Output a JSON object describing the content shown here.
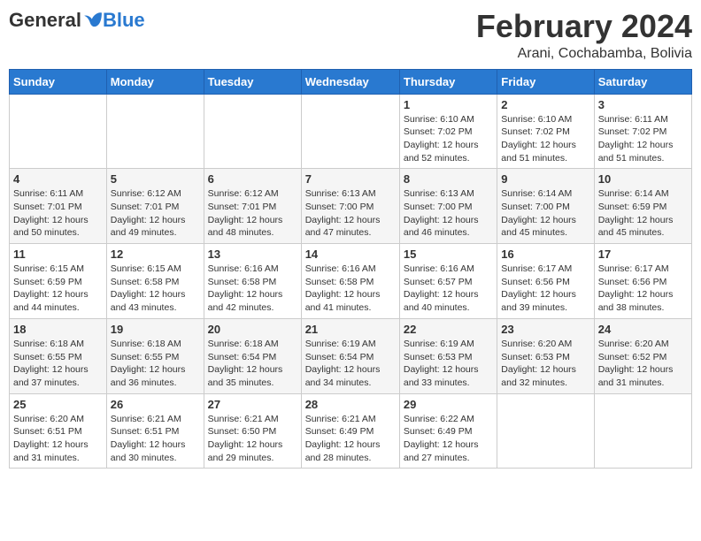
{
  "logo": {
    "general": "General",
    "blue": "Blue"
  },
  "title": {
    "month_year": "February 2024",
    "location": "Arani, Cochabamba, Bolivia"
  },
  "weekdays": [
    "Sunday",
    "Monday",
    "Tuesday",
    "Wednesday",
    "Thursday",
    "Friday",
    "Saturday"
  ],
  "weeks": [
    [
      {
        "day": "",
        "info": ""
      },
      {
        "day": "",
        "info": ""
      },
      {
        "day": "",
        "info": ""
      },
      {
        "day": "",
        "info": ""
      },
      {
        "day": "1",
        "info": "Sunrise: 6:10 AM\nSunset: 7:02 PM\nDaylight: 12 hours\nand 52 minutes."
      },
      {
        "day": "2",
        "info": "Sunrise: 6:10 AM\nSunset: 7:02 PM\nDaylight: 12 hours\nand 51 minutes."
      },
      {
        "day": "3",
        "info": "Sunrise: 6:11 AM\nSunset: 7:02 PM\nDaylight: 12 hours\nand 51 minutes."
      }
    ],
    [
      {
        "day": "4",
        "info": "Sunrise: 6:11 AM\nSunset: 7:01 PM\nDaylight: 12 hours\nand 50 minutes."
      },
      {
        "day": "5",
        "info": "Sunrise: 6:12 AM\nSunset: 7:01 PM\nDaylight: 12 hours\nand 49 minutes."
      },
      {
        "day": "6",
        "info": "Sunrise: 6:12 AM\nSunset: 7:01 PM\nDaylight: 12 hours\nand 48 minutes."
      },
      {
        "day": "7",
        "info": "Sunrise: 6:13 AM\nSunset: 7:00 PM\nDaylight: 12 hours\nand 47 minutes."
      },
      {
        "day": "8",
        "info": "Sunrise: 6:13 AM\nSunset: 7:00 PM\nDaylight: 12 hours\nand 46 minutes."
      },
      {
        "day": "9",
        "info": "Sunrise: 6:14 AM\nSunset: 7:00 PM\nDaylight: 12 hours\nand 45 minutes."
      },
      {
        "day": "10",
        "info": "Sunrise: 6:14 AM\nSunset: 6:59 PM\nDaylight: 12 hours\nand 45 minutes."
      }
    ],
    [
      {
        "day": "11",
        "info": "Sunrise: 6:15 AM\nSunset: 6:59 PM\nDaylight: 12 hours\nand 44 minutes."
      },
      {
        "day": "12",
        "info": "Sunrise: 6:15 AM\nSunset: 6:58 PM\nDaylight: 12 hours\nand 43 minutes."
      },
      {
        "day": "13",
        "info": "Sunrise: 6:16 AM\nSunset: 6:58 PM\nDaylight: 12 hours\nand 42 minutes."
      },
      {
        "day": "14",
        "info": "Sunrise: 6:16 AM\nSunset: 6:58 PM\nDaylight: 12 hours\nand 41 minutes."
      },
      {
        "day": "15",
        "info": "Sunrise: 6:16 AM\nSunset: 6:57 PM\nDaylight: 12 hours\nand 40 minutes."
      },
      {
        "day": "16",
        "info": "Sunrise: 6:17 AM\nSunset: 6:56 PM\nDaylight: 12 hours\nand 39 minutes."
      },
      {
        "day": "17",
        "info": "Sunrise: 6:17 AM\nSunset: 6:56 PM\nDaylight: 12 hours\nand 38 minutes."
      }
    ],
    [
      {
        "day": "18",
        "info": "Sunrise: 6:18 AM\nSunset: 6:55 PM\nDaylight: 12 hours\nand 37 minutes."
      },
      {
        "day": "19",
        "info": "Sunrise: 6:18 AM\nSunset: 6:55 PM\nDaylight: 12 hours\nand 36 minutes."
      },
      {
        "day": "20",
        "info": "Sunrise: 6:18 AM\nSunset: 6:54 PM\nDaylight: 12 hours\nand 35 minutes."
      },
      {
        "day": "21",
        "info": "Sunrise: 6:19 AM\nSunset: 6:54 PM\nDaylight: 12 hours\nand 34 minutes."
      },
      {
        "day": "22",
        "info": "Sunrise: 6:19 AM\nSunset: 6:53 PM\nDaylight: 12 hours\nand 33 minutes."
      },
      {
        "day": "23",
        "info": "Sunrise: 6:20 AM\nSunset: 6:53 PM\nDaylight: 12 hours\nand 32 minutes."
      },
      {
        "day": "24",
        "info": "Sunrise: 6:20 AM\nSunset: 6:52 PM\nDaylight: 12 hours\nand 31 minutes."
      }
    ],
    [
      {
        "day": "25",
        "info": "Sunrise: 6:20 AM\nSunset: 6:51 PM\nDaylight: 12 hours\nand 31 minutes."
      },
      {
        "day": "26",
        "info": "Sunrise: 6:21 AM\nSunset: 6:51 PM\nDaylight: 12 hours\nand 30 minutes."
      },
      {
        "day": "27",
        "info": "Sunrise: 6:21 AM\nSunset: 6:50 PM\nDaylight: 12 hours\nand 29 minutes."
      },
      {
        "day": "28",
        "info": "Sunrise: 6:21 AM\nSunset: 6:49 PM\nDaylight: 12 hours\nand 28 minutes."
      },
      {
        "day": "29",
        "info": "Sunrise: 6:22 AM\nSunset: 6:49 PM\nDaylight: 12 hours\nand 27 minutes."
      },
      {
        "day": "",
        "info": ""
      },
      {
        "day": "",
        "info": ""
      }
    ]
  ]
}
